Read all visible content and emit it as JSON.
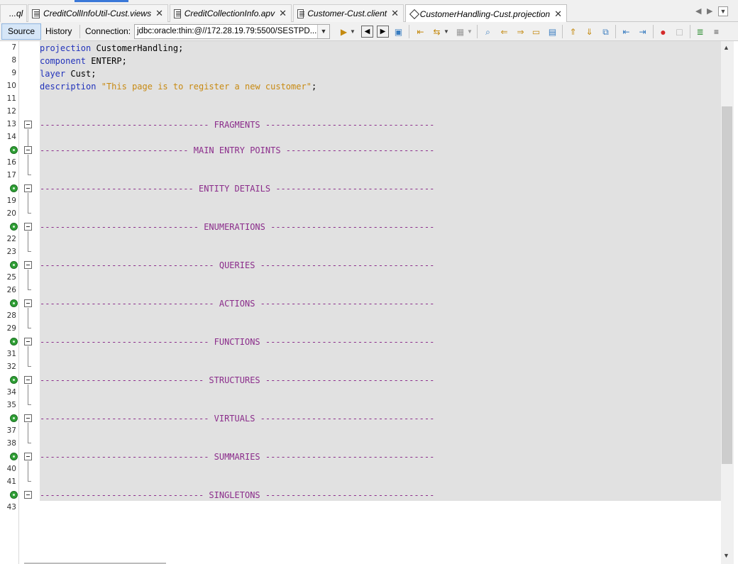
{
  "tabs": [
    {
      "label": "...ql",
      "icon": "none",
      "active": false
    },
    {
      "label": "CreditCollInfoUtil-Cust.views",
      "icon": "file-icon",
      "active": false
    },
    {
      "label": "CreditCollectionInfo.apv",
      "icon": "file-icon",
      "active": false
    },
    {
      "label": "Customer-Cust.client",
      "icon": "file-icon",
      "active": false
    },
    {
      "label": "CustomerHandling-Cust.projection",
      "icon": "projection-icon",
      "active": true
    }
  ],
  "toolbar": {
    "source_label": "Source",
    "history_label": "History",
    "connection_label": "Connection:",
    "connection_value": "jdbc:oracle:thin:@//172.28.19.79:5500/SESTPD..."
  },
  "editor": {
    "lines": [
      {
        "n": "7",
        "text": "projection CustomerHandling;"
      },
      {
        "n": "8",
        "text": "component ENTERP;"
      },
      {
        "n": "9",
        "text": "layer Cust;"
      },
      {
        "n": "10",
        "text": "description \"This page is to register a new customer\";"
      },
      {
        "n": "11",
        "text": ""
      },
      {
        "n": "12",
        "text": ""
      },
      {
        "n": "13",
        "text": "--------------------------------- FRAGMENTS ---------------------------------"
      },
      {
        "n": "14",
        "text": ""
      },
      {
        "n": "15",
        "text": "----------------------------- MAIN ENTRY POINTS -----------------------------"
      },
      {
        "n": "16",
        "text": ""
      },
      {
        "n": "17",
        "text": ""
      },
      {
        "n": "18",
        "text": "------------------------------ ENTITY DETAILS -------------------------------"
      },
      {
        "n": "19",
        "text": ""
      },
      {
        "n": "20",
        "text": ""
      },
      {
        "n": "21",
        "text": "------------------------------- ENUMERATIONS --------------------------------"
      },
      {
        "n": "22",
        "text": ""
      },
      {
        "n": "23",
        "text": ""
      },
      {
        "n": "24",
        "text": "---------------------------------- QUERIES ----------------------------------"
      },
      {
        "n": "25",
        "text": ""
      },
      {
        "n": "26",
        "text": ""
      },
      {
        "n": "27",
        "text": "---------------------------------- ACTIONS ----------------------------------"
      },
      {
        "n": "28",
        "text": ""
      },
      {
        "n": "29",
        "text": ""
      },
      {
        "n": "30",
        "text": "--------------------------------- FUNCTIONS ---------------------------------"
      },
      {
        "n": "31",
        "text": ""
      },
      {
        "n": "32",
        "text": ""
      },
      {
        "n": "33",
        "text": "-------------------------------- STRUCTURES ---------------------------------"
      },
      {
        "n": "34",
        "text": ""
      },
      {
        "n": "35",
        "text": ""
      },
      {
        "n": "36",
        "text": "--------------------------------- VIRTUALS ----------------------------------"
      },
      {
        "n": "37",
        "text": ""
      },
      {
        "n": "38",
        "text": ""
      },
      {
        "n": "39",
        "text": "--------------------------------- SUMMARIES ---------------------------------"
      },
      {
        "n": "40",
        "text": ""
      },
      {
        "n": "41",
        "text": ""
      },
      {
        "n": "42",
        "text": "-------------------------------- SINGLETONS ---------------------------------"
      },
      {
        "n": "43",
        "text": ""
      }
    ]
  }
}
